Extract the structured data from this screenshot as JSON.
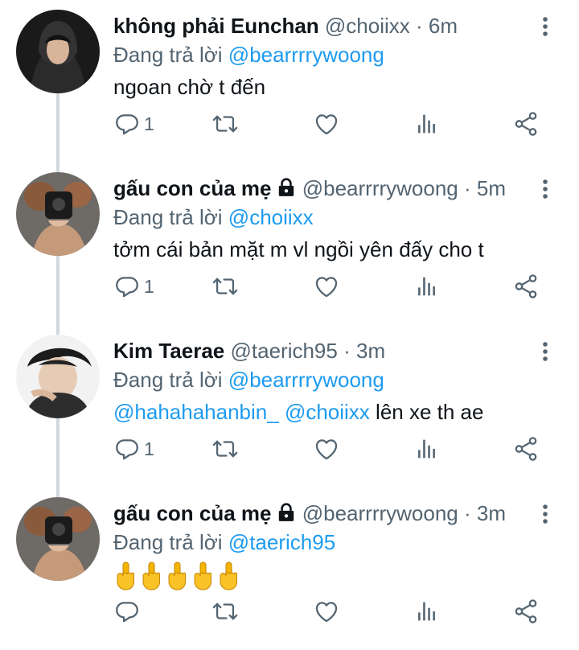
{
  "colors": {
    "link": "#1d9bf0",
    "secondary_text": "#536471",
    "primary_text": "#0f1419",
    "thread_line": "#cfd9de"
  },
  "tweets": [
    {
      "display_name": "không phải Eunchan",
      "handle": "@choiixx",
      "dot": "·",
      "time": "6m",
      "protected": false,
      "reply_prefix": "Đang trả lời",
      "reply_to": "@bearrrrywoong",
      "text": "ngoan chờ t đến",
      "reply_count": "1"
    },
    {
      "display_name": "gấu con của mẹ",
      "handle": "@bearrrrywoong",
      "dot": "·",
      "time": "5m",
      "protected": true,
      "reply_prefix": "Đang trả lời",
      "reply_to": "@choiixx",
      "text": "tởm cái bản mặt m vl ngồi yên đấy cho t",
      "reply_count": "1"
    },
    {
      "display_name": "Kim Taerae",
      "handle": "@taerich95",
      "dot": "·",
      "time": "3m",
      "protected": false,
      "reply_prefix": "Đang trả lời",
      "reply_to": "@bearrrrywoong",
      "text_mention_1": "@hahahahanbin_",
      "text_mention_2": "@choiixx",
      "text_rest": "lên xe th ae",
      "reply_count": "1"
    },
    {
      "display_name": "gấu con của mẹ",
      "handle": "@bearrrrywoong",
      "dot": "·",
      "time": "3m",
      "protected": true,
      "reply_prefix": "Đang trả lời",
      "reply_to": "@taerich95",
      "emoji": [
        "middle-finger-emoji",
        "middle-finger-emoji",
        "middle-finger-emoji",
        "middle-finger-emoji",
        "middle-finger-emoji"
      ],
      "reply_count": ""
    }
  ],
  "icons": {
    "reply": "reply-icon",
    "retweet": "retweet-icon",
    "like": "heart-icon",
    "stats": "analytics-icon",
    "share": "share-icon",
    "menu": "more-vertical-icon",
    "lock": "lock-icon"
  }
}
